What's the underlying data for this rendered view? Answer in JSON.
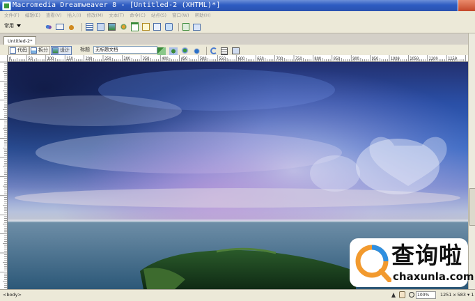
{
  "window": {
    "title": "Macromedia Dreamweaver 8 - [Untitled-2 (XHTML)*]"
  },
  "menu": [
    "文件(F)",
    "编辑(E)",
    "查看(V)",
    "插入(I)",
    "修改(M)",
    "文本(T)",
    "命令(C)",
    "站点(S)",
    "窗口(W)",
    "帮助(H)"
  ],
  "insert_bar": {
    "category": "常用"
  },
  "document": {
    "tab": "Untitled-2*",
    "view_code": "代码",
    "view_split": "拆分",
    "view_design": "设计",
    "title_label": "标题",
    "title_value": "无标题文档"
  },
  "ruler_ticks": [
    "0",
    "50",
    "100",
    "150",
    "200",
    "250",
    "300",
    "350",
    "400",
    "450",
    "500",
    "550",
    "600",
    "650",
    "700",
    "750",
    "800",
    "850",
    "900",
    "950",
    "1000",
    "1050",
    "1100",
    "1150"
  ],
  "status": {
    "tag": "<body>",
    "zoom": "100%",
    "window_size": "1251 x 583 ▾ 1"
  },
  "watermark": {
    "brand_cn": "查询啦",
    "brand_en": "chaxunla.com"
  },
  "icons": [
    "app-icon",
    "dropdown-arrow-icon",
    "hyperlink-icon",
    "email-link-icon",
    "named-anchor-icon",
    "table-icon",
    "layer-icon",
    "image-icon",
    "media-icon",
    "date-icon",
    "comment-icon",
    "templates-icon",
    "tag-chooser-icon",
    "code-view-icon",
    "split-view-icon",
    "design-view-icon",
    "validate-icon",
    "file-management-icon",
    "preview-icon",
    "refresh-icon",
    "view-options-icon",
    "visual-aids-icon",
    "select-tool-icon",
    "hand-tool-icon",
    "zoom-tool-icon",
    "search-logo-icon"
  ]
}
